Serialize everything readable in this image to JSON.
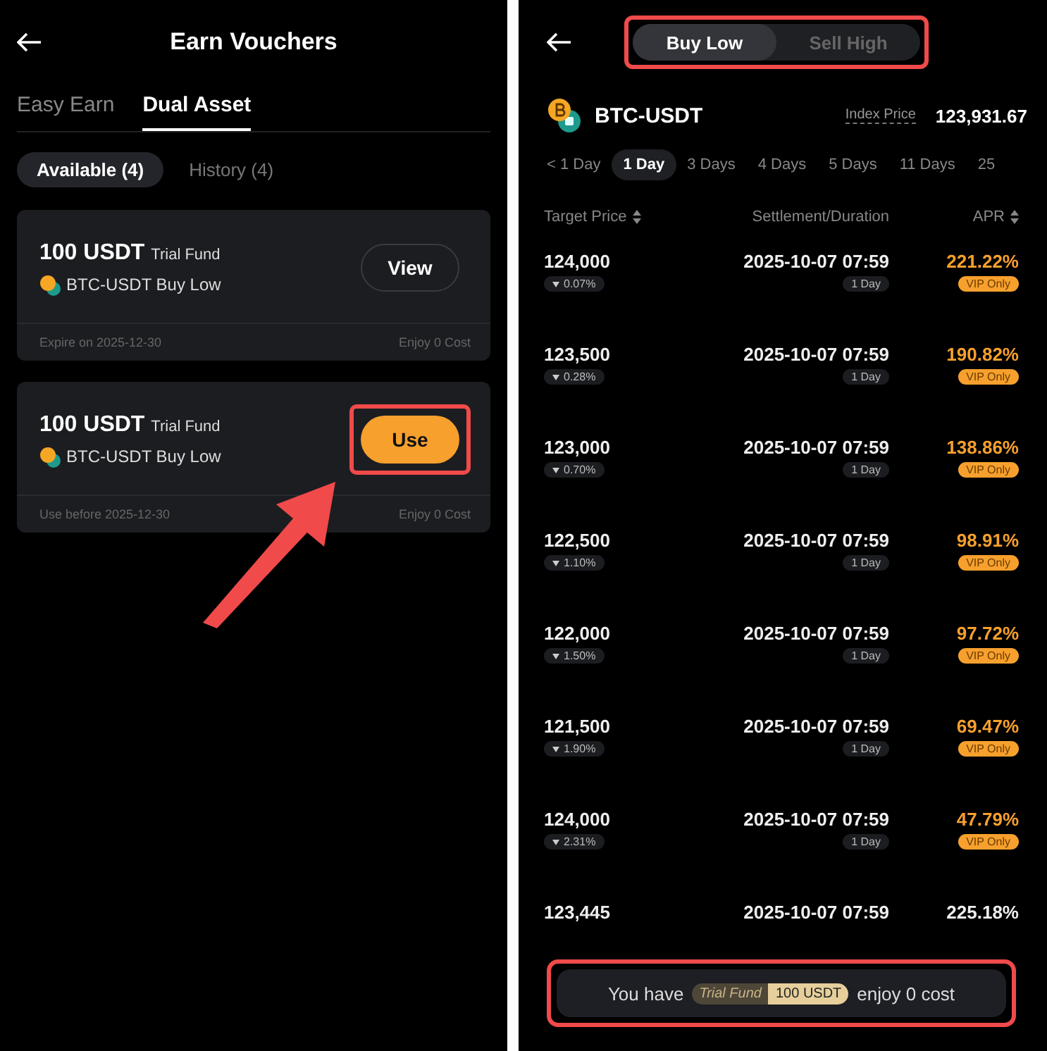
{
  "left": {
    "title": "Earn Vouchers",
    "tabs": [
      {
        "label": "Easy Earn",
        "selected": false
      },
      {
        "label": "Dual Asset",
        "selected": true
      }
    ],
    "filters": [
      {
        "label": "Available (4)",
        "selected": true
      },
      {
        "label": "History (4)",
        "selected": false
      }
    ],
    "vouchers": [
      {
        "amount": "100 USDT",
        "type": "Trial Fund",
        "product": "BTC-USDT Buy Low",
        "footer_left": "Expire on 2025-12-30",
        "footer_right": "Enjoy 0 Cost",
        "button": "View",
        "kind": "outline",
        "highlighted": false
      },
      {
        "amount": "100 USDT",
        "type": "Trial Fund",
        "product": "BTC-USDT Buy Low",
        "footer_left": "Use before 2025-12-30",
        "footer_right": "Enjoy 0 Cost",
        "button": "Use",
        "kind": "primary",
        "highlighted": true
      }
    ]
  },
  "right": {
    "modes": [
      {
        "label": "Buy Low",
        "selected": true
      },
      {
        "label": "Sell High",
        "selected": false
      }
    ],
    "modes_highlighted": true,
    "pair": "BTC-USDT",
    "index_label": "Index Price",
    "index_price": "123,931.67",
    "durations": [
      {
        "label": "< 1 Day",
        "selected": false
      },
      {
        "label": "1 Day",
        "selected": true
      },
      {
        "label": "3 Days",
        "selected": false
      },
      {
        "label": "4 Days",
        "selected": false
      },
      {
        "label": "5 Days",
        "selected": false
      },
      {
        "label": "11 Days",
        "selected": false
      },
      {
        "label": "25",
        "selected": false
      }
    ],
    "columns": [
      {
        "label": "Target Price",
        "sortable": true
      },
      {
        "label": "Settlement/Duration",
        "sortable": false
      },
      {
        "label": "APR",
        "sortable": true
      }
    ],
    "rows": [
      {
        "price": "124,000",
        "change": "0.07%",
        "settlement": "2025-10-07 07:59",
        "duration": "1 Day",
        "apr": "221.22%",
        "vip": "VIP Only"
      },
      {
        "price": "123,500",
        "change": "0.28%",
        "settlement": "2025-10-07 07:59",
        "duration": "1 Day",
        "apr": "190.82%",
        "vip": "VIP Only"
      },
      {
        "price": "123,000",
        "change": "0.70%",
        "settlement": "2025-10-07 07:59",
        "duration": "1 Day",
        "apr": "138.86%",
        "vip": "VIP Only"
      },
      {
        "price": "122,500",
        "change": "1.10%",
        "settlement": "2025-10-07 07:59",
        "duration": "1 Day",
        "apr": "98.91%",
        "vip": "VIP Only"
      },
      {
        "price": "122,000",
        "change": "1.50%",
        "settlement": "2025-10-07 07:59",
        "duration": "1 Day",
        "apr": "97.72%",
        "vip": "VIP Only"
      },
      {
        "price": "121,500",
        "change": "1.90%",
        "settlement": "2025-10-07 07:59",
        "duration": "1 Day",
        "apr": "69.47%",
        "vip": "VIP Only"
      },
      {
        "price": "124,000",
        "change": "2.31%",
        "settlement": "2025-10-07 07:59",
        "duration": "1 Day",
        "apr": "47.79%",
        "vip": "VIP Only"
      },
      {
        "price": "123,445",
        "settlement": "2025-10-07 07:59",
        "apr": "225.18%"
      }
    ],
    "banner": {
      "prefix": "You have",
      "tag_label": "Trial Fund",
      "tag_value": "100 USDT",
      "suffix": "enjoy 0 cost",
      "highlighted": true
    }
  }
}
